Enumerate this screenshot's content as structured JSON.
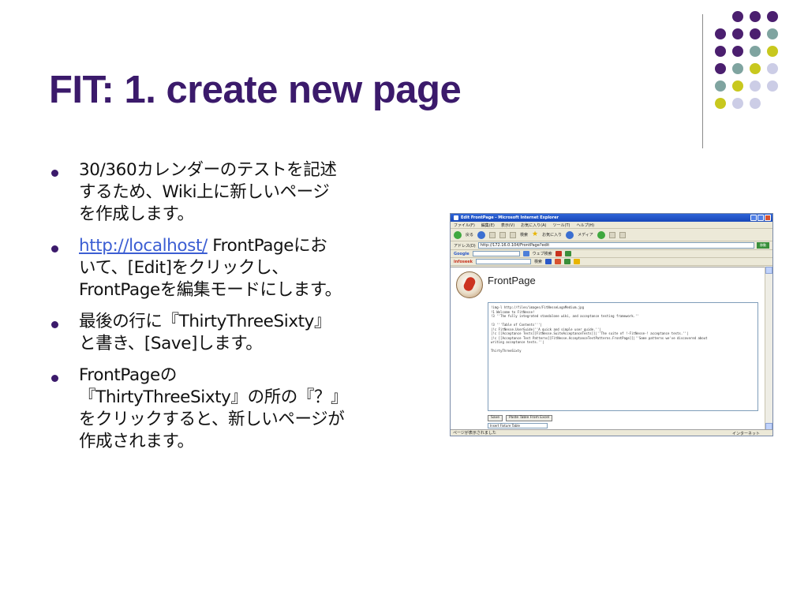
{
  "slide": {
    "title": "FIT: 1. create new page",
    "bullets": [
      {
        "lines": [
          "30/360カレンダーのテストを記述",
          "するため、Wiki上に新しいページ",
          "を作成します。"
        ]
      },
      {
        "link": "http://localhost/",
        "lines": [
          " FrontPageにお",
          "いて、[Edit]をクリックし、",
          "FrontPageを編集モードにします。"
        ]
      },
      {
        "lines": [
          "最後の行に『ThirtyThreeSixty』",
          "と書き、[Save]します。"
        ]
      },
      {
        "lines": [
          "FrontPageの",
          "『ThirtyThreeSixty』の所の『？』",
          "をクリックすると、新しいページが",
          "作成されます。"
        ]
      }
    ]
  },
  "colors": {
    "title": "#3b1a6b",
    "dot_purple": "#4b1f6f",
    "dot_teal": "#7fa4a0",
    "dot_yellow": "#c8c81e",
    "dot_lavender": "#cccde6",
    "link": "#3c5ed3"
  },
  "browser": {
    "window_title": "Edit FrontPage - Microsoft Internet Explorer",
    "menu": [
      "ファイル(F)",
      "編集(E)",
      "表示(V)",
      "お気に入り(A)",
      "ツール(T)",
      "ヘルプ(H)"
    ],
    "toolbar": {
      "back": "戻る",
      "search": "検索",
      "favorites": "お気に入り",
      "media": "メディア"
    },
    "address_label": "アドレス(D)",
    "address": "http://172.16.0.104/FrontPage?edit",
    "go_label": "移動",
    "google_label": "Google",
    "google_search": "ウェブ検索",
    "infoseek_label": "infoseek",
    "infoseek_search": "検索",
    "page_heading": "FrontPage",
    "edit_text": "!img-l http://files/images/FitNesseLogoMedium.jpg\n!1 Welcome to FitNesse!\n!3 ''The fully integrated standalone wiki, and acceptance testing framework.''\n\n!3 '''Table of Contents'''|\n|!c FitNesse.UserGuide|''A quick and simple user guide.''|\n|!c [[Acceptance Tests][FitNesse.SuiteAcceptanceTests]]|''The suite of !-FitNesse-! acceptance tests.''|\n|!c [[Acceptance Test Patterns][FitNesse.AcceptanceTestPatterns.FrontPage]]|''Some patterns we've discovered about\nwriting acceptance tests.''|\n\nThirtyThreeSixty",
    "save_label": "Save",
    "paste_label": "Paste Table From Excel",
    "dropdown_label": "Insert Fixture Table",
    "status_text": "ページが表示されました",
    "status_zone": "インターネット"
  }
}
